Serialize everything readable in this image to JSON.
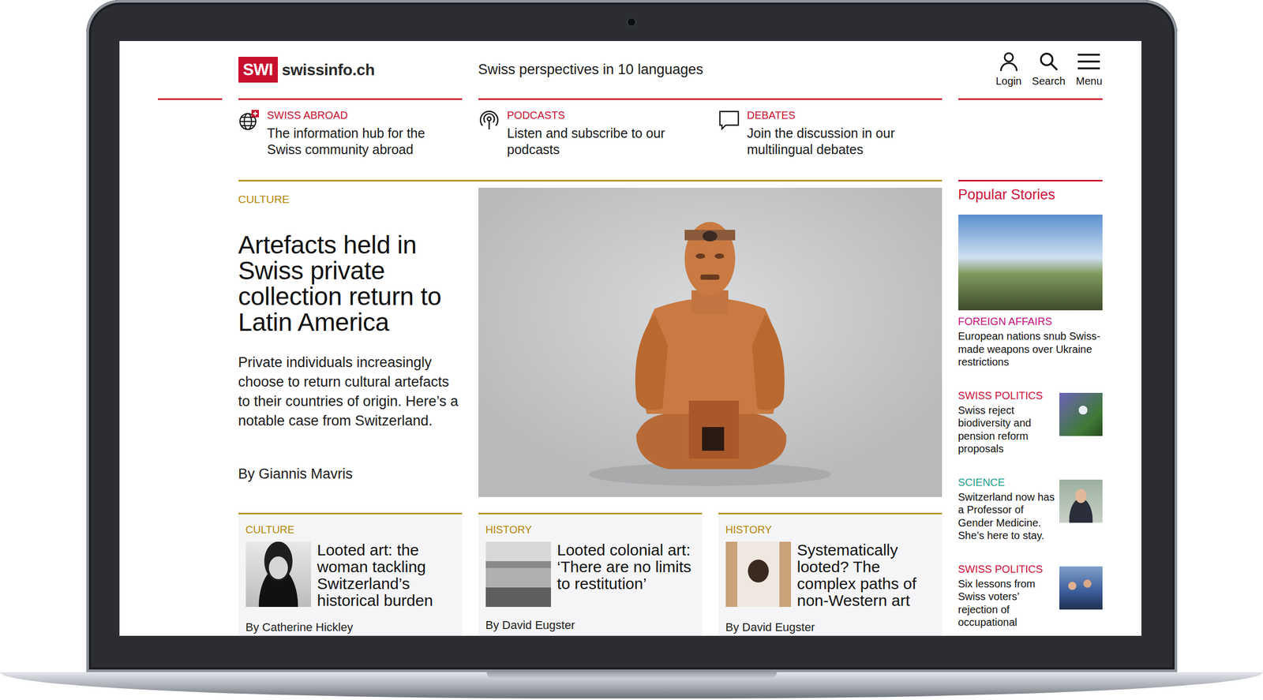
{
  "header": {
    "logo_mark": "SWI",
    "logo_text": "swissinfo.ch",
    "tagline": "Swiss perspectives in 10 languages",
    "actions": [
      {
        "label": "Login"
      },
      {
        "label": "Search"
      },
      {
        "label": "Menu"
      }
    ]
  },
  "quick_links": [
    {
      "label": "SWISS ABROAD",
      "text": "The information hub for the Swiss community abroad"
    },
    {
      "label": "PODCASTS",
      "text": "Listen and subscribe to our podcasts"
    },
    {
      "label": "DEBATES",
      "text": "Join the discussion in our multilingual debates"
    }
  ],
  "hero": {
    "category": "CULTURE",
    "title": "Artefacts held in Swiss private collection return to Latin America",
    "summary": "Private individuals increasingly choose to return cultural artefacts to their countries of origin. Here’s a notable case from Switzerland.",
    "author": "By Giannis Mavris"
  },
  "cards": [
    {
      "category": "CULTURE",
      "title": "Looted art: the woman tackling Switzerland’s historical burden",
      "author": "By Catherine Hickley"
    },
    {
      "category": "HISTORY",
      "title": "Looted colonial art: ‘There are no limits to restitution’",
      "author": "By David Eugster"
    },
    {
      "category": "HISTORY",
      "title": "Systematically looted? The complex paths of non-Western art",
      "author": "By David Eugster"
    }
  ],
  "popular": {
    "title": "Popular Stories",
    "items": [
      {
        "category": "FOREIGN AFFAIRS",
        "title": "European nations snub Swiss-made weapons over Ukraine restrictions",
        "color": "#c4127a",
        "kind": "large"
      },
      {
        "category": "SWISS POLITICS",
        "title": "Swiss reject biodiversity and pension reform proposals",
        "color": "#d0103a",
        "kind": "thumb"
      },
      {
        "category": "SCIENCE",
        "title": "Switzerland now has a Professor of Gender Medicine. She’s here to stay.",
        "color": "#1f9e8e",
        "kind": "thumb"
      },
      {
        "category": "SWISS POLITICS",
        "title": "Six lessons from Swiss voters’ rejection of occupational",
        "color": "#d0103a",
        "kind": "thumb"
      }
    ]
  }
}
